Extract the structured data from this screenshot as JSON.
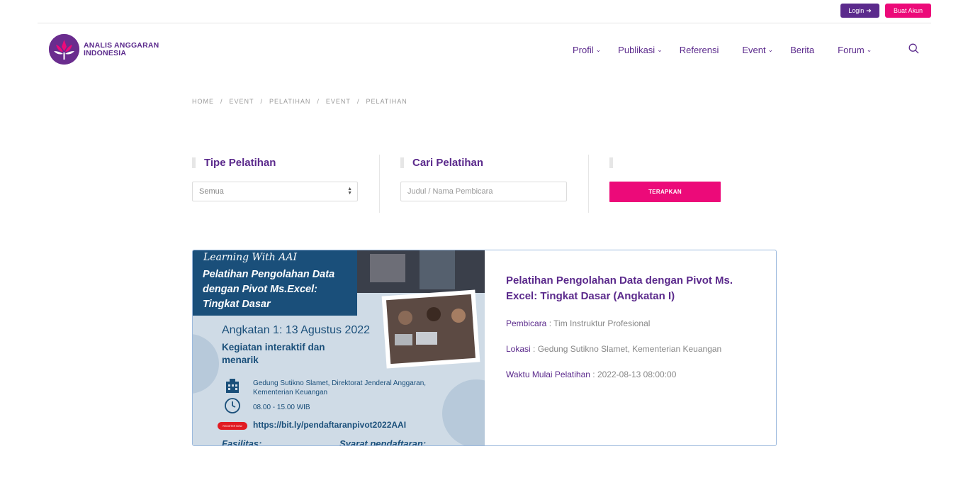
{
  "topbar": {
    "login_label": "Login",
    "signup_label": "Buat Akun"
  },
  "logo": {
    "line1": "ANALIS ANGGARAN",
    "line2": "INDONESIA"
  },
  "nav": {
    "items": [
      {
        "label": "Profil",
        "dropdown": true
      },
      {
        "label": "Publikasi",
        "dropdown": true
      },
      {
        "label": "Referensi",
        "dropdown": false
      },
      {
        "label": "Event",
        "dropdown": true
      },
      {
        "label": "Berita",
        "dropdown": false
      },
      {
        "label": "Forum",
        "dropdown": true
      }
    ]
  },
  "breadcrumb": [
    "HOME",
    "EVENT",
    "PELATIHAN",
    "EVENT",
    "PELATIHAN"
  ],
  "filters": {
    "type_title": "Tipe Pelatihan",
    "type_value": "Semua",
    "search_title": "Cari Pelatihan",
    "search_placeholder": "Judul / Nama Pembicara",
    "apply_label": "TERAPKAN"
  },
  "card": {
    "title": "Pelatihan Pengolahan Data dengan Pivot Ms. Excel: Tingkat Dasar (Angkatan I)",
    "speaker_label": "Pembicara",
    "speaker_value": "Tim Instruktur Profesional",
    "location_label": "Lokasi",
    "location_value": "Gedung Sutikno Slamet, Kementerian Keuangan",
    "start_label": "Waktu Mulai Pelatihan",
    "start_value": "2022-08-13 08:00:00"
  },
  "poster": {
    "learning": "Learning With AAI",
    "headline_1": "Pelatihan Pengolahan Data",
    "headline_2": "dengan Pivot Ms.Excel:",
    "headline_3": "Tingkat Dasar",
    "angkatan": "Angkatan 1: 13 Agustus 2022",
    "kegiatan_1": "Kegiatan interaktif dan",
    "kegiatan_2": "menarik",
    "location_1": "Gedung Sutikno Slamet, Direktorat Jenderal Anggaran,",
    "location_2": "Kementerian Keuangan",
    "time": "08.00 - 15.00 WIB",
    "register": "REGISTER NOW",
    "url": "https://bit.ly/pendaftaranpivot2022AAI",
    "fasilitas": "Fasilitas:",
    "syarat": "Syarat pendaftaran:"
  },
  "colors": {
    "brand_purple": "#5b2a8c",
    "brand_pink": "#ec0a79",
    "poster_blue": "#1a4f7a"
  }
}
